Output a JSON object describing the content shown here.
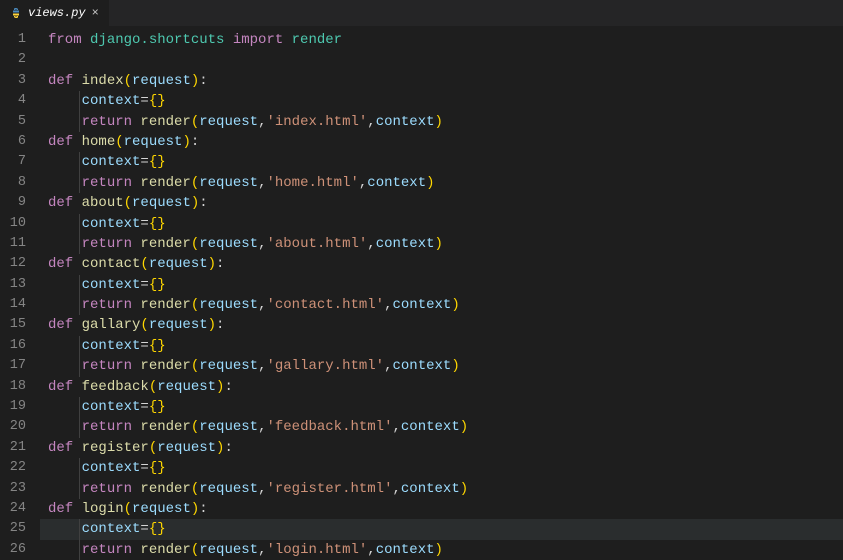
{
  "tab": {
    "filename": "views.py",
    "close_label": "×"
  },
  "code": {
    "lines": [
      {
        "n": 1,
        "indent": 0,
        "tokens": [
          {
            "t": "from ",
            "c": "kw"
          },
          {
            "t": "django.shortcuts ",
            "c": "mod"
          },
          {
            "t": "import ",
            "c": "kw"
          },
          {
            "t": "render",
            "c": "mod"
          }
        ]
      },
      {
        "n": 2,
        "indent": 0,
        "tokens": []
      },
      {
        "n": 3,
        "indent": 0,
        "tokens": [
          {
            "t": "def ",
            "c": "kw"
          },
          {
            "t": "index",
            "c": "fn"
          },
          {
            "t": "(",
            "c": "brace"
          },
          {
            "t": "request",
            "c": "param"
          },
          {
            "t": ")",
            "c": "brace"
          },
          {
            "t": ":",
            "c": "punc"
          }
        ]
      },
      {
        "n": 4,
        "indent": 1,
        "tokens": [
          {
            "t": "context",
            "c": "param"
          },
          {
            "t": "=",
            "c": "op"
          },
          {
            "t": "{}",
            "c": "brace"
          }
        ]
      },
      {
        "n": 5,
        "indent": 1,
        "tokens": [
          {
            "t": "return ",
            "c": "kw"
          },
          {
            "t": "render",
            "c": "fn"
          },
          {
            "t": "(",
            "c": "brace"
          },
          {
            "t": "request",
            "c": "param"
          },
          {
            "t": ",",
            "c": "punc"
          },
          {
            "t": "'index.html'",
            "c": "str"
          },
          {
            "t": ",",
            "c": "punc"
          },
          {
            "t": "context",
            "c": "param"
          },
          {
            "t": ")",
            "c": "brace"
          }
        ]
      },
      {
        "n": 6,
        "indent": 0,
        "tokens": [
          {
            "t": "def ",
            "c": "kw"
          },
          {
            "t": "home",
            "c": "fn"
          },
          {
            "t": "(",
            "c": "brace"
          },
          {
            "t": "request",
            "c": "param"
          },
          {
            "t": ")",
            "c": "brace"
          },
          {
            "t": ":",
            "c": "punc"
          }
        ]
      },
      {
        "n": 7,
        "indent": 1,
        "tokens": [
          {
            "t": "context",
            "c": "param"
          },
          {
            "t": "=",
            "c": "op"
          },
          {
            "t": "{}",
            "c": "brace"
          }
        ]
      },
      {
        "n": 8,
        "indent": 1,
        "tokens": [
          {
            "t": "return ",
            "c": "kw"
          },
          {
            "t": "render",
            "c": "fn"
          },
          {
            "t": "(",
            "c": "brace"
          },
          {
            "t": "request",
            "c": "param"
          },
          {
            "t": ",",
            "c": "punc"
          },
          {
            "t": "'home.html'",
            "c": "str"
          },
          {
            "t": ",",
            "c": "punc"
          },
          {
            "t": "context",
            "c": "param"
          },
          {
            "t": ")",
            "c": "brace"
          }
        ]
      },
      {
        "n": 9,
        "indent": 0,
        "tokens": [
          {
            "t": "def ",
            "c": "kw"
          },
          {
            "t": "about",
            "c": "fn"
          },
          {
            "t": "(",
            "c": "brace"
          },
          {
            "t": "request",
            "c": "param"
          },
          {
            "t": ")",
            "c": "brace"
          },
          {
            "t": ":",
            "c": "punc"
          }
        ]
      },
      {
        "n": 10,
        "indent": 1,
        "tokens": [
          {
            "t": "context",
            "c": "param"
          },
          {
            "t": "=",
            "c": "op"
          },
          {
            "t": "{}",
            "c": "brace"
          }
        ]
      },
      {
        "n": 11,
        "indent": 1,
        "tokens": [
          {
            "t": "return ",
            "c": "kw"
          },
          {
            "t": "render",
            "c": "fn"
          },
          {
            "t": "(",
            "c": "brace"
          },
          {
            "t": "request",
            "c": "param"
          },
          {
            "t": ",",
            "c": "punc"
          },
          {
            "t": "'about.html'",
            "c": "str"
          },
          {
            "t": ",",
            "c": "punc"
          },
          {
            "t": "context",
            "c": "param"
          },
          {
            "t": ")",
            "c": "brace"
          }
        ]
      },
      {
        "n": 12,
        "indent": 0,
        "tokens": [
          {
            "t": "def ",
            "c": "kw"
          },
          {
            "t": "contact",
            "c": "fn"
          },
          {
            "t": "(",
            "c": "brace"
          },
          {
            "t": "request",
            "c": "param"
          },
          {
            "t": ")",
            "c": "brace"
          },
          {
            "t": ":",
            "c": "punc"
          }
        ]
      },
      {
        "n": 13,
        "indent": 1,
        "tokens": [
          {
            "t": "context",
            "c": "param"
          },
          {
            "t": "=",
            "c": "op"
          },
          {
            "t": "{}",
            "c": "brace"
          }
        ]
      },
      {
        "n": 14,
        "indent": 1,
        "tokens": [
          {
            "t": "return ",
            "c": "kw"
          },
          {
            "t": "render",
            "c": "fn"
          },
          {
            "t": "(",
            "c": "brace"
          },
          {
            "t": "request",
            "c": "param"
          },
          {
            "t": ",",
            "c": "punc"
          },
          {
            "t": "'contact.html'",
            "c": "str"
          },
          {
            "t": ",",
            "c": "punc"
          },
          {
            "t": "context",
            "c": "param"
          },
          {
            "t": ")",
            "c": "brace"
          }
        ]
      },
      {
        "n": 15,
        "indent": 0,
        "tokens": [
          {
            "t": "def ",
            "c": "kw"
          },
          {
            "t": "gallary",
            "c": "fn"
          },
          {
            "t": "(",
            "c": "brace"
          },
          {
            "t": "request",
            "c": "param"
          },
          {
            "t": ")",
            "c": "brace"
          },
          {
            "t": ":",
            "c": "punc"
          }
        ]
      },
      {
        "n": 16,
        "indent": 1,
        "tokens": [
          {
            "t": "context",
            "c": "param"
          },
          {
            "t": "=",
            "c": "op"
          },
          {
            "t": "{}",
            "c": "brace"
          }
        ]
      },
      {
        "n": 17,
        "indent": 1,
        "tokens": [
          {
            "t": "return ",
            "c": "kw"
          },
          {
            "t": "render",
            "c": "fn"
          },
          {
            "t": "(",
            "c": "brace"
          },
          {
            "t": "request",
            "c": "param"
          },
          {
            "t": ",",
            "c": "punc"
          },
          {
            "t": "'gallary.html'",
            "c": "str"
          },
          {
            "t": ",",
            "c": "punc"
          },
          {
            "t": "context",
            "c": "param"
          },
          {
            "t": ")",
            "c": "brace"
          }
        ]
      },
      {
        "n": 18,
        "indent": 0,
        "tokens": [
          {
            "t": "def ",
            "c": "kw"
          },
          {
            "t": "feedback",
            "c": "fn"
          },
          {
            "t": "(",
            "c": "brace"
          },
          {
            "t": "request",
            "c": "param"
          },
          {
            "t": ")",
            "c": "brace"
          },
          {
            "t": ":",
            "c": "punc"
          }
        ]
      },
      {
        "n": 19,
        "indent": 1,
        "tokens": [
          {
            "t": "context",
            "c": "param"
          },
          {
            "t": "=",
            "c": "op"
          },
          {
            "t": "{}",
            "c": "brace"
          }
        ]
      },
      {
        "n": 20,
        "indent": 1,
        "tokens": [
          {
            "t": "return ",
            "c": "kw"
          },
          {
            "t": "render",
            "c": "fn"
          },
          {
            "t": "(",
            "c": "brace"
          },
          {
            "t": "request",
            "c": "param"
          },
          {
            "t": ",",
            "c": "punc"
          },
          {
            "t": "'feedback.html'",
            "c": "str"
          },
          {
            "t": ",",
            "c": "punc"
          },
          {
            "t": "context",
            "c": "param"
          },
          {
            "t": ")",
            "c": "brace"
          }
        ]
      },
      {
        "n": 21,
        "indent": 0,
        "tokens": [
          {
            "t": "def ",
            "c": "kw"
          },
          {
            "t": "register",
            "c": "fn"
          },
          {
            "t": "(",
            "c": "brace"
          },
          {
            "t": "request",
            "c": "param"
          },
          {
            "t": ")",
            "c": "brace"
          },
          {
            "t": ":",
            "c": "punc"
          }
        ]
      },
      {
        "n": 22,
        "indent": 1,
        "tokens": [
          {
            "t": "context",
            "c": "param"
          },
          {
            "t": "=",
            "c": "op"
          },
          {
            "t": "{}",
            "c": "brace"
          }
        ]
      },
      {
        "n": 23,
        "indent": 1,
        "tokens": [
          {
            "t": "return ",
            "c": "kw"
          },
          {
            "t": "render",
            "c": "fn"
          },
          {
            "t": "(",
            "c": "brace"
          },
          {
            "t": "request",
            "c": "param"
          },
          {
            "t": ",",
            "c": "punc"
          },
          {
            "t": "'register.html'",
            "c": "str"
          },
          {
            "t": ",",
            "c": "punc"
          },
          {
            "t": "context",
            "c": "param"
          },
          {
            "t": ")",
            "c": "brace"
          }
        ]
      },
      {
        "n": 24,
        "indent": 0,
        "tokens": [
          {
            "t": "def ",
            "c": "kw"
          },
          {
            "t": "login",
            "c": "fn"
          },
          {
            "t": "(",
            "c": "brace"
          },
          {
            "t": "request",
            "c": "param"
          },
          {
            "t": ")",
            "c": "brace"
          },
          {
            "t": ":",
            "c": "punc"
          }
        ]
      },
      {
        "n": 25,
        "indent": 1,
        "hl": true,
        "tokens": [
          {
            "t": "context",
            "c": "param"
          },
          {
            "t": "=",
            "c": "op"
          },
          {
            "t": "{}",
            "c": "brace"
          }
        ]
      },
      {
        "n": 26,
        "indent": 1,
        "tokens": [
          {
            "t": "return ",
            "c": "kw"
          },
          {
            "t": "render",
            "c": "fn"
          },
          {
            "t": "(",
            "c": "brace"
          },
          {
            "t": "request",
            "c": "param"
          },
          {
            "t": ",",
            "c": "punc"
          },
          {
            "t": "'login.html'",
            "c": "str"
          },
          {
            "t": ",",
            "c": "punc"
          },
          {
            "t": "context",
            "c": "param"
          },
          {
            "t": ")",
            "c": "brace"
          }
        ]
      }
    ]
  }
}
